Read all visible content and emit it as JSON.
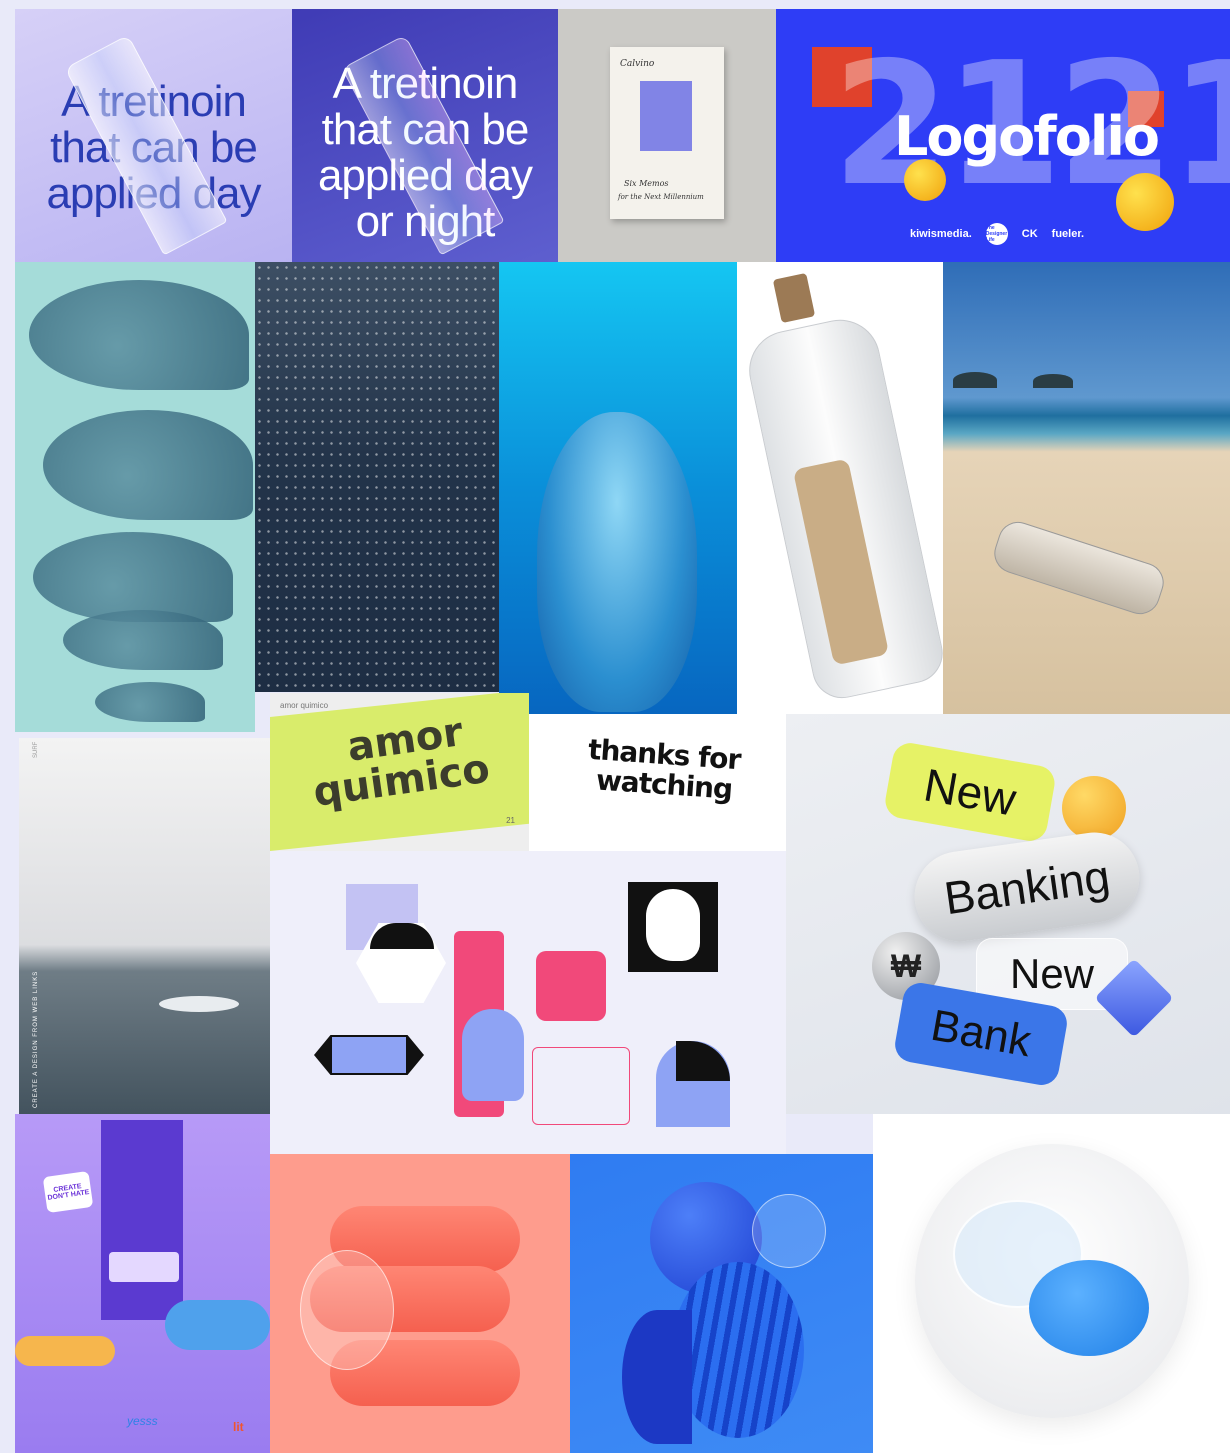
{
  "retinoin_light": {
    "line1": "A tretinoin",
    "line2": "that can be",
    "line3": "applied day"
  },
  "retinoin_dark": {
    "line1": "A tretinoin",
    "line2": "that can be",
    "line3": "applied day",
    "line4": "or night"
  },
  "calvino": {
    "title": "Calvino",
    "line1": "Six Memos",
    "line2": "for the Next Millennium"
  },
  "logofolio": {
    "big": "2121",
    "title": "Logofolio",
    "footer": [
      "kiwismedia.",
      "The Designer Life",
      "CK",
      "fueler."
    ]
  },
  "amor": {
    "corner": "amor quimico",
    "line1": "amor",
    "line2": "quimico",
    "number": "21"
  },
  "thanks": {
    "line1": "thanks for",
    "line2": "watching"
  },
  "surf": {
    "vertical": "CREATE A DESIGN FROM WEB LINKS",
    "top": "SURF"
  },
  "banking": {
    "new1": "New",
    "banking": "Banking",
    "new2": "New",
    "bank": "Bank",
    "coin": "₩"
  },
  "locker": {
    "sticker1": "CREATE DON'T HATE",
    "sticker2": "yesss",
    "sticker3": "lit"
  }
}
